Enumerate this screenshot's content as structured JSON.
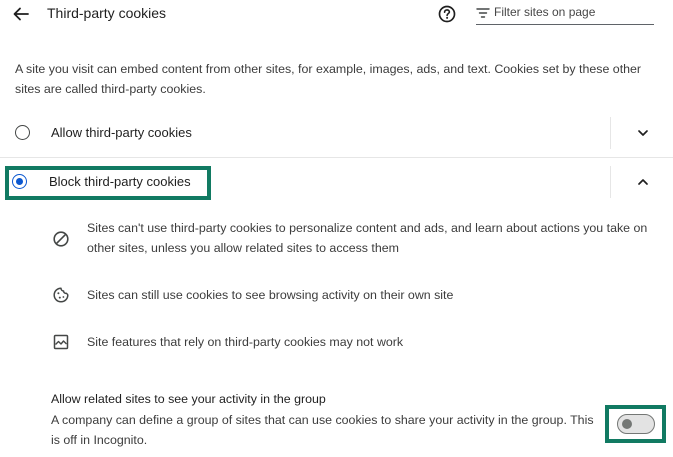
{
  "header": {
    "title": "Third-party cookies",
    "back_icon": "arrow-back-icon",
    "help_icon": "help-circle-icon",
    "filter_icon": "filter-icon",
    "filter_placeholder": "Filter sites on page",
    "filter_value": ""
  },
  "description": "A site you visit can embed content from other sites, for example, images, ads, and text. Cookies set by these other sites are called third-party cookies.",
  "options": [
    {
      "label": "Allow third-party cookies",
      "selected": false,
      "expanded": false,
      "expand_icon": "chevron-down-icon"
    },
    {
      "label": "Block third-party cookies",
      "selected": true,
      "expanded": true,
      "expand_icon": "chevron-up-icon"
    }
  ],
  "block_details": [
    {
      "icon": "block-icon",
      "text": "Sites can't use third-party cookies to personalize content and ads, and learn about actions you take on other sites, unless you allow related sites to access them"
    },
    {
      "icon": "cookie-icon",
      "text": "Sites can still use cookies to see browsing activity on their own site"
    },
    {
      "icon": "image-broken-icon",
      "text": "Site features that rely on third-party cookies may not work"
    }
  ],
  "related_sites": {
    "title": "Allow related sites to see your activity in the group",
    "description": "A company can define a group of sites that can use cookies to share your activity in the group. This is off in Incognito.",
    "toggle_on": false
  },
  "colors": {
    "accent": "#0b57d0",
    "highlight": "#117a62",
    "text": "#1f1f1f",
    "secondary_text": "#3c3c3c"
  }
}
